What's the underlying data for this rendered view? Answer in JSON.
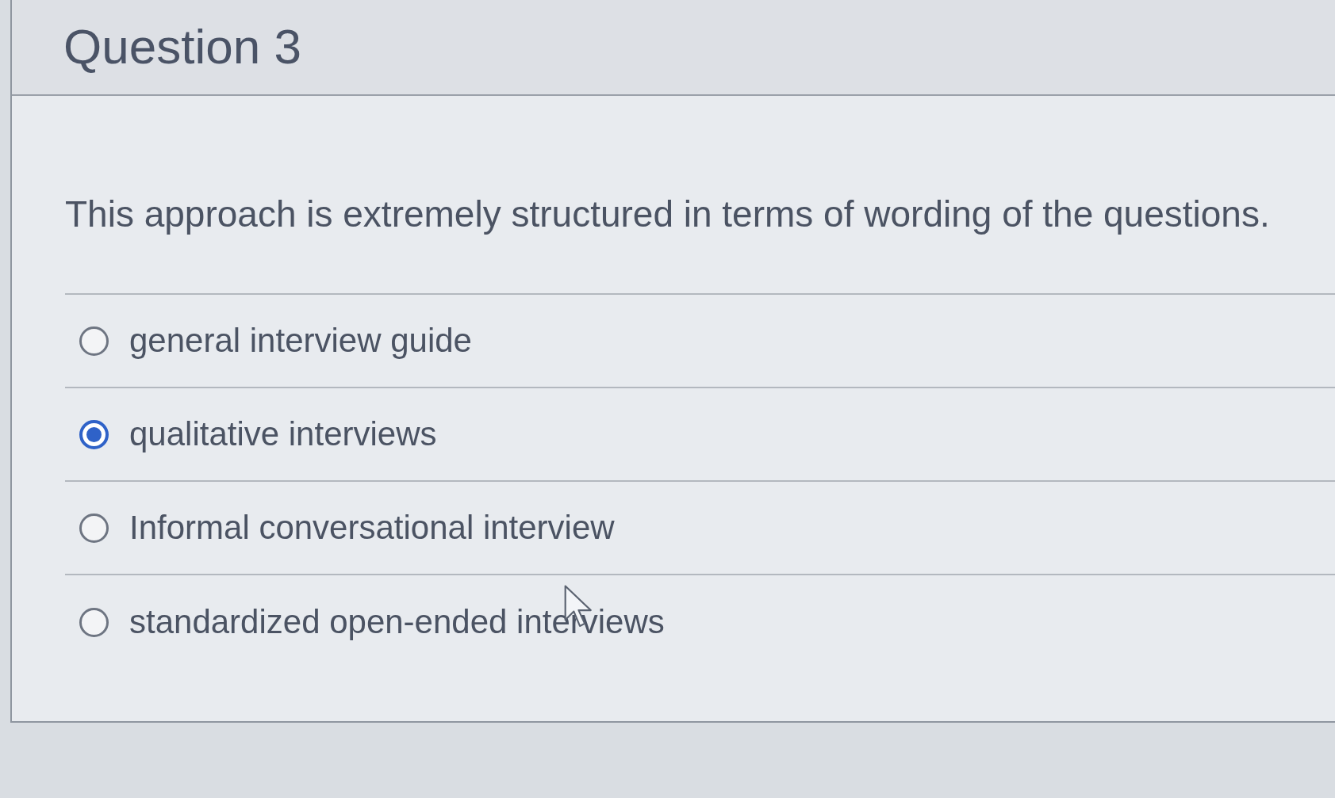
{
  "question": {
    "title": "Question 3",
    "prompt": "This approach is extremely structured in terms of wording of the questions.",
    "options": [
      {
        "label": "general interview guide",
        "selected": false
      },
      {
        "label": "qualitative interviews",
        "selected": true
      },
      {
        "label": "Informal conversational interview",
        "selected": false
      },
      {
        "label": "standardized open-ended interviews",
        "selected": false
      }
    ]
  }
}
